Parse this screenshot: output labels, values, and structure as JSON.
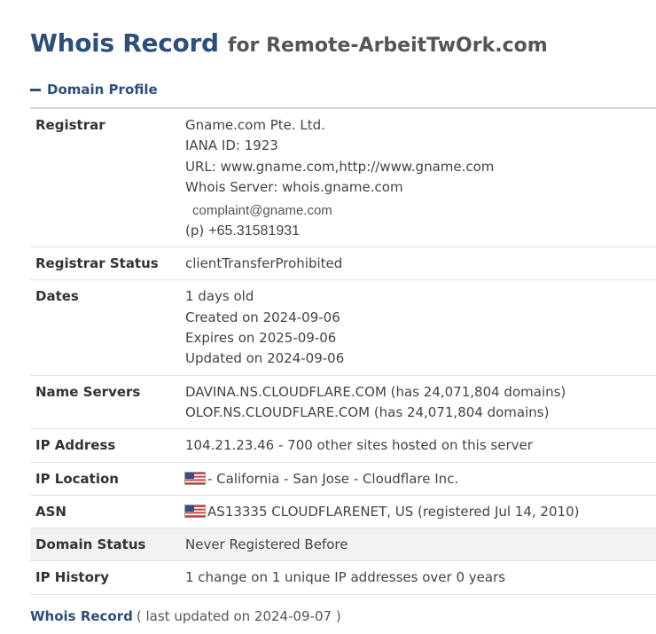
{
  "header": {
    "title_main": "Whois Record",
    "title_rest": "for Remote-ArbeitTwOrk.com"
  },
  "section": {
    "label": "Domain Profile",
    "icon": "collapse-minus-icon"
  },
  "registrar": {
    "label": "Registrar",
    "name": "Gname.com Pte. Ltd.",
    "iana": "IANA ID: 1923",
    "url": "URL: www.gname.com,http://www.gname.com",
    "whois_server": "Whois Server: whois.gname.com",
    "email": "complaint@gname.com",
    "phone_prefix": "(p)",
    "phone": "+65.31581931"
  },
  "registrar_status": {
    "label": "Registrar Status",
    "value": "clientTransferProhibited"
  },
  "dates": {
    "label": "Dates",
    "age": "1 days old",
    "created": "Created on 2024-09-06",
    "expires": "Expires on 2025-09-06",
    "updated": "Updated on 2024-09-06"
  },
  "name_servers": {
    "label": "Name Servers",
    "ns1": "DAVINA.NS.CLOUDFLARE.COM (has 24,071,804 domains)",
    "ns2": "OLOF.NS.CLOUDFLARE.COM (has 24,071,804 domains)"
  },
  "ip_address": {
    "label": "IP Address",
    "value": "104.21.23.46 - 700 other sites hosted on this server"
  },
  "ip_location": {
    "label": "IP Location",
    "value": "- California - San Jose - Cloudflare Inc.",
    "flag": "us-flag-icon"
  },
  "asn": {
    "label": "ASN",
    "value": "AS13335 CLOUDFLARENET, US (registered Jul 14, 2010)",
    "flag": "us-flag-icon"
  },
  "domain_status": {
    "label": "Domain Status",
    "value": "Never Registered Before"
  },
  "ip_history": {
    "label": "IP History",
    "value": "1 change on 1 unique IP addresses over 0 years"
  },
  "footer": {
    "link": "Whois Record",
    "note": "( last updated on 2024-09-07 )"
  },
  "colors": {
    "brand": "#2e4f7b",
    "row_shade": "#f2f2f2",
    "rule": "#d4d4d4"
  }
}
